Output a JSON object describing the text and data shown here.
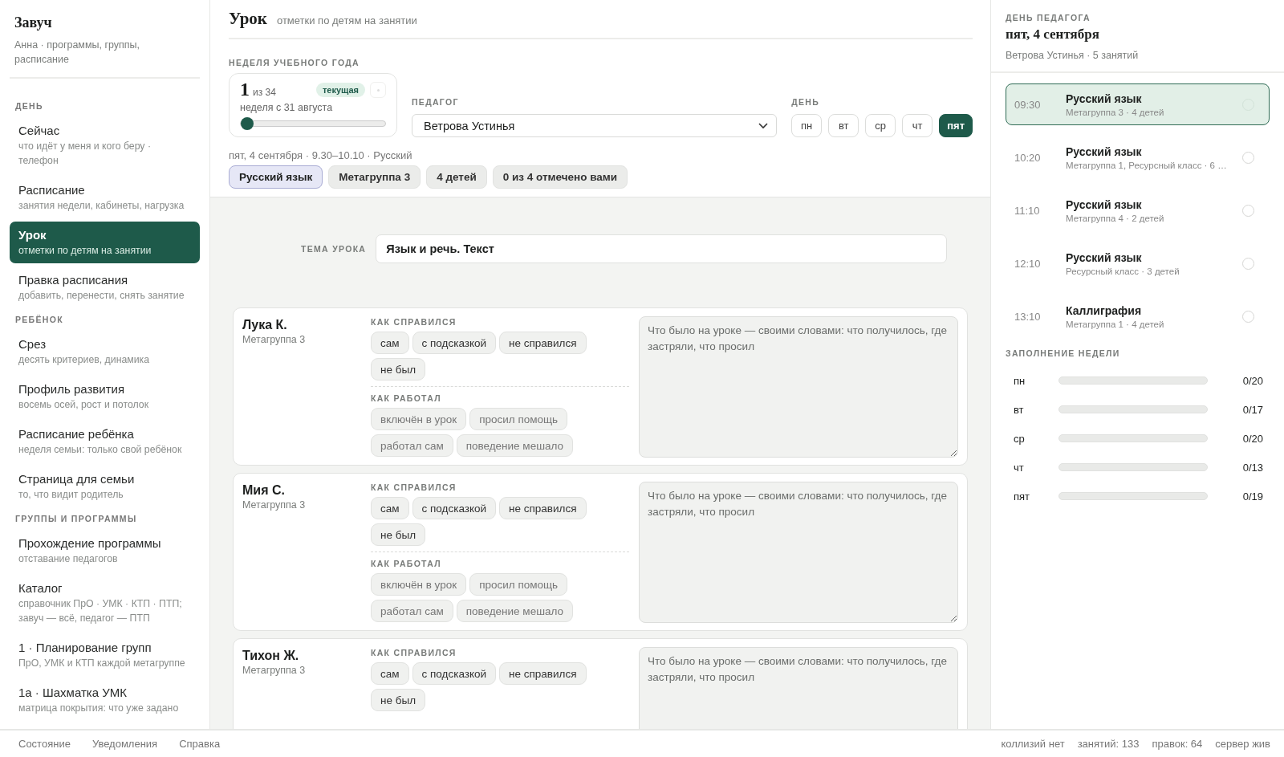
{
  "sidebar": {
    "title": "Завуч",
    "subtitle": "Анна · программы, группы, расписание",
    "sections": [
      {
        "heading": "ДЕНЬ",
        "items": [
          {
            "label": "Сейчас",
            "hint": "что идёт у меня и кого беру · телефон",
            "selected": false
          },
          {
            "label": "Расписание",
            "hint": "занятия недели, кабинеты, нагрузка",
            "selected": false
          },
          {
            "label": "Урок",
            "hint": "отметки по детям на занятии",
            "selected": true
          },
          {
            "label": "Правка расписания",
            "hint": "добавить, перенести, снять занятие",
            "selected": false
          }
        ]
      },
      {
        "heading": "РЕБЁНОК",
        "items": [
          {
            "label": "Срез",
            "hint": "десять критериев, динамика",
            "selected": false
          },
          {
            "label": "Профиль развития",
            "hint": "восемь осей, рост и потолок",
            "selected": false
          },
          {
            "label": "Расписание ребёнка",
            "hint": "неделя семьи: только свой ребёнок",
            "selected": false
          },
          {
            "label": "Страница для семьи",
            "hint": "то, что видит родитель",
            "selected": false
          }
        ]
      },
      {
        "heading": "ГРУППЫ И ПРОГРАММЫ",
        "items": [
          {
            "label": "Прохождение программы",
            "hint": "отставание педагогов",
            "selected": false
          },
          {
            "label": "Каталог",
            "hint": "справочник ПрО · УМК · КТП · ПТП; завуч — всё, педагог — ПТП",
            "selected": false
          },
          {
            "label": "1 · Планирование групп",
            "hint": "ПрО, УМК и КТП каждой метагруппе",
            "selected": false
          },
          {
            "label": "1а · Шахматка УМК",
            "hint": "матрица покрытия: что уже задано",
            "selected": false
          }
        ]
      }
    ]
  },
  "main": {
    "title": "Урок",
    "subtitle": "отметки по детям на занятии",
    "week": {
      "label": "НЕДЕЛЯ УЧЕБНОГО ГОДА",
      "number": "1",
      "of": "из 34",
      "badge": "текущая",
      "caption": "неделя с 31 августа",
      "level": 0
    },
    "teacher": {
      "label": "ПЕДАГОГ",
      "value": "Ветрова Устинья"
    },
    "days": {
      "label": "ДЕНЬ",
      "items": [
        {
          "label": "пн",
          "selected": false
        },
        {
          "label": "вт",
          "selected": false
        },
        {
          "label": "ср",
          "selected": false
        },
        {
          "label": "чт",
          "selected": false
        },
        {
          "label": "пят",
          "selected": true
        }
      ]
    },
    "lesson_line": "пят, 4 сентября · 9.30–10.10 · Русский",
    "chips": [
      {
        "label": "Русский язык",
        "kind": "subject"
      },
      {
        "label": "Метагруппа 3",
        "kind": "info"
      },
      {
        "label": "4 детей",
        "kind": "info"
      },
      {
        "label": "0 из 4 отмечено вами",
        "kind": "info"
      }
    ],
    "topic": {
      "label": "ТЕМА УРОКА",
      "value": "Язык и речь. Текст"
    },
    "children": [
      {
        "name": "Лука К.",
        "group": "Метагруппа 3",
        "sections": [
          {
            "heading": "КАК СПРАВИЛСЯ",
            "kind": "result",
            "options": [
              {
                "label": "сам",
                "selected": false
              },
              {
                "label": "с подсказкой",
                "selected": false
              },
              {
                "label": "не справился",
                "selected": false
              },
              {
                "label": "не был",
                "selected": false
              }
            ]
          },
          {
            "heading": "КАК РАБОТАЛ",
            "kind": "behavior",
            "options": [
              {
                "label": "включён в урок",
                "selected": false
              },
              {
                "label": "просил помощь",
                "selected": false
              },
              {
                "label": "работал сам",
                "selected": false
              },
              {
                "label": "поведение мешало",
                "selected": false
              }
            ]
          }
        ],
        "note": {
          "placeholder": "Что было на уроке — своими словами: что получилось, где застряли, что просил"
        }
      },
      {
        "name": "Мия С.",
        "group": "Метагруппа 3",
        "sections": [
          {
            "heading": "КАК СПРАВИЛСЯ",
            "kind": "result",
            "options": [
              {
                "label": "сам",
                "selected": false
              },
              {
                "label": "с подсказкой",
                "selected": false
              },
              {
                "label": "не справился",
                "selected": false
              },
              {
                "label": "не был",
                "selected": false
              }
            ]
          },
          {
            "heading": "КАК РАБОТАЛ",
            "kind": "behavior",
            "options": [
              {
                "label": "включён в урок",
                "selected": false
              },
              {
                "label": "просил помощь",
                "selected": false
              },
              {
                "label": "работал сам",
                "selected": false
              },
              {
                "label": "поведение мешало",
                "selected": false
              }
            ]
          }
        ],
        "note": {
          "placeholder": "Что было на уроке — своими словами: что получилось, где застряли, что просил"
        }
      },
      {
        "name": "Тихон Ж.",
        "group": "Метагруппа 3",
        "sections": [
          {
            "heading": "КАК СПРАВИЛСЯ",
            "kind": "result",
            "options": [
              {
                "label": "сам",
                "selected": false
              },
              {
                "label": "с подсказкой",
                "selected": false
              },
              {
                "label": "не справился",
                "selected": false
              },
              {
                "label": "не был",
                "selected": false
              }
            ]
          }
        ],
        "note": {
          "placeholder": "Что было на уроке — своими словами: что получилось, где застряли, что просил"
        }
      }
    ]
  },
  "day_panel": {
    "label": "ДЕНЬ ПЕДАГОГА",
    "date": "пят, 4 сентября",
    "summary": "Ветрова Устинья · 5 занятий",
    "lessons": [
      {
        "time": "09:30",
        "title": "Русский язык",
        "meta": "Метагруппа 3 · 4 детей",
        "selected": true
      },
      {
        "time": "10:20",
        "title": "Русский язык",
        "meta": "Метагруппа 1, Ресурсный класс · 6 …",
        "selected": false
      },
      {
        "time": "11:10",
        "title": "Русский язык",
        "meta": "Метагруппа 4 · 2 детей",
        "selected": false
      },
      {
        "time": "12:10",
        "title": "Русский язык",
        "meta": "Ресурсный класс · 3 детей",
        "selected": false
      },
      {
        "time": "13:10",
        "title": "Каллиграфия",
        "meta": "Метагруппа 1 · 4 детей",
        "selected": false
      }
    ],
    "fill": {
      "label": "ЗАПОЛНЕНИЕ НЕДЕЛИ",
      "rows": [
        {
          "day": "пн",
          "level": 0,
          "count": "0/20"
        },
        {
          "day": "вт",
          "level": 0,
          "count": "0/17"
        },
        {
          "day": "ср",
          "level": 0,
          "count": "0/20"
        },
        {
          "day": "чт",
          "level": 0,
          "count": "0/13"
        },
        {
          "day": "пят",
          "level": 0,
          "count": "0/19"
        }
      ]
    }
  },
  "footer": {
    "links": [
      "Состояние",
      "Уведомления",
      "Справка"
    ],
    "status": [
      "коллизий нет",
      "занятий: 133",
      "правок: 64",
      "сервер жив"
    ]
  }
}
